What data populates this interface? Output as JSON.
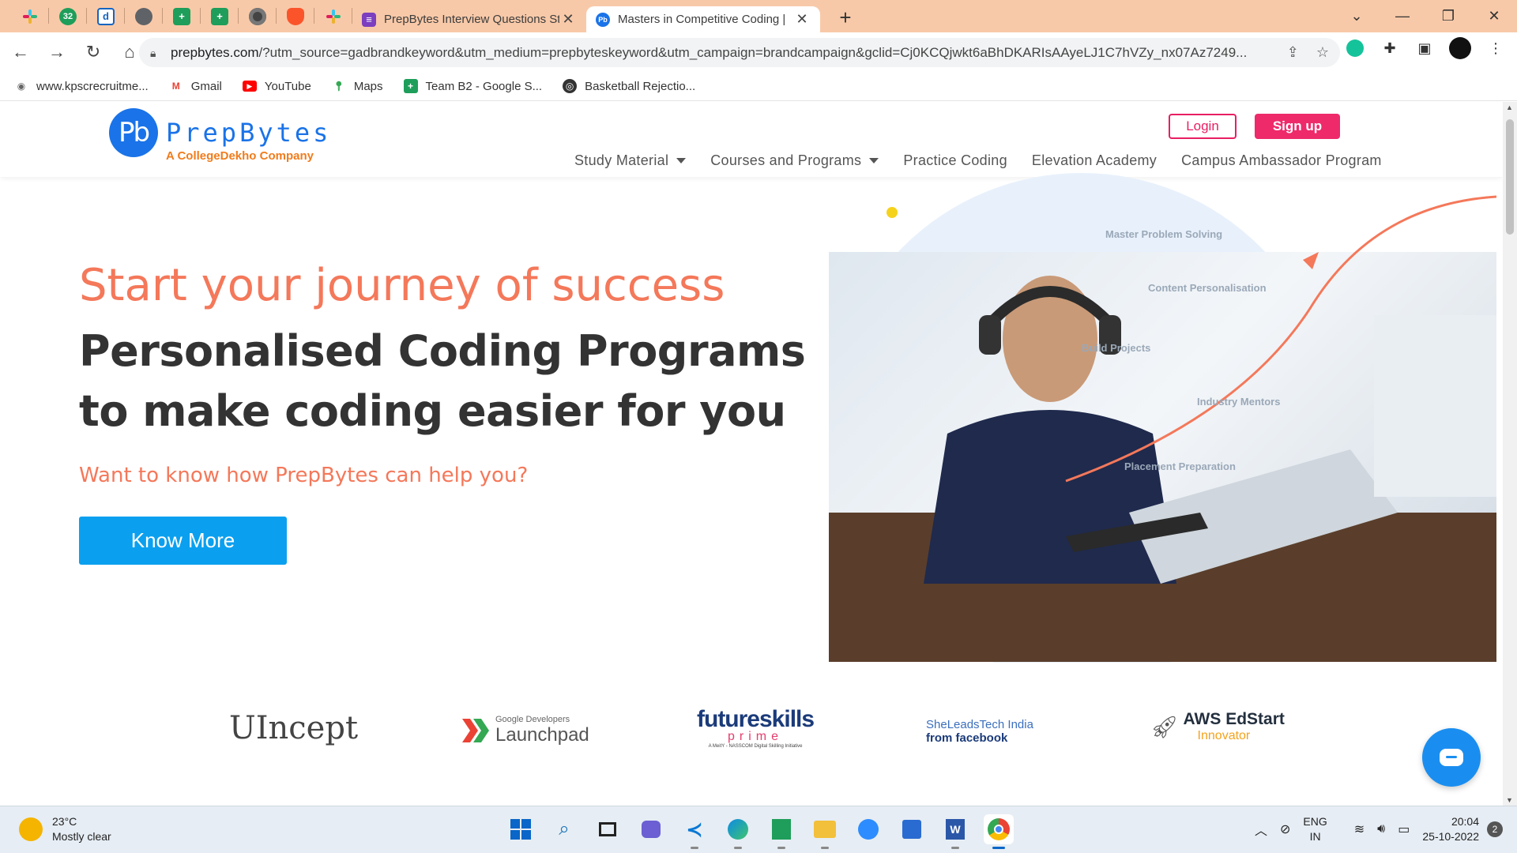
{
  "browser": {
    "tabs": [
      {
        "title": "PrepBytes Interview Questions St",
        "icon": "form-icon"
      },
      {
        "title": "Masters in Competitive Coding |",
        "icon": "prepbytes-icon",
        "active": true
      }
    ],
    "pinned_badge": "32",
    "url_domain": "prepbytes.com",
    "url_rest": "/?utm_source=gadbrandkeyword&utm_medium=prepbyteskeyword&utm_campaign=brandcampaign&gclid=Cj0KCQjwkt6aBhDKARIsAAyeLJ1C7hVZy_nx07Az7249...",
    "bookmarks": [
      {
        "label": "www.kpscrecruitme...",
        "icon": "kpsc-icon"
      },
      {
        "label": "Gmail",
        "icon": "gmail-icon"
      },
      {
        "label": "YouTube",
        "icon": "youtube-icon"
      },
      {
        "label": "Maps",
        "icon": "maps-icon"
      },
      {
        "label": "Team B2 - Google S...",
        "icon": "sheets-icon"
      },
      {
        "label": "Basketball Rejectio...",
        "icon": "globe-icon"
      }
    ]
  },
  "site": {
    "logo_mark": "Pb",
    "logo_name": "PrepBytes",
    "logo_sub": "A CollegeDekho Company",
    "login": "Login",
    "signup": "Sign up",
    "nav": [
      {
        "label": "Study Material",
        "dropdown": true
      },
      {
        "label": "Courses and Programs",
        "dropdown": true
      },
      {
        "label": "Practice Coding",
        "dropdown": false
      },
      {
        "label": "Elevation Academy",
        "dropdown": false
      },
      {
        "label": "Campus Ambassador Program",
        "dropdown": false
      }
    ],
    "hero": {
      "tagline": "Start your journey of success",
      "title_line1": "Personalised Coding Programs",
      "title_line2": "to make coding easier for you",
      "question": "Want to know how PrepBytes can help you?",
      "cta": "Know More"
    },
    "art_labels": [
      "Master Problem Solving",
      "Content Personalisation",
      "Build Projects",
      "Industry Mentors",
      "Placement Preparation"
    ],
    "partners": {
      "uincept": "UIncept",
      "google_small": "Google Developers",
      "google_big": "Launchpad",
      "futureskills": "futureskills",
      "futureskills_prime": "prime",
      "futureskills_sub": "A MeitY - NASSCOM Digital Skilling Initiative",
      "sheleads_line1": "SheLeadsTech India",
      "sheleads_line2": "from facebook",
      "aws_line1": "AWS EdStart",
      "aws_line2": "Innovator"
    }
  },
  "taskbar": {
    "temp": "23°C",
    "weather": "Mostly clear",
    "lang": "ENG",
    "region": "IN",
    "time": "20:04",
    "date": "25-10-2022",
    "notifications": "2"
  },
  "colors": {
    "accent_orange": "#f4785a",
    "brand_blue": "#1a73e8",
    "cta_blue": "#0ba0ef",
    "signup_pink": "#ee2a6b"
  }
}
